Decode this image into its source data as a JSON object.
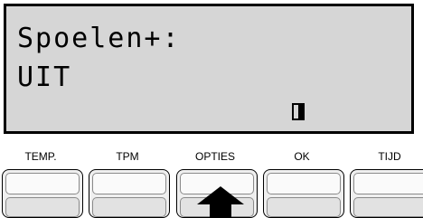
{
  "display": {
    "line1": "Spoelen+:",
    "line2": "UIT",
    "cursor_icon": "block-cursor-icon"
  },
  "softkeys": [
    {
      "label": "TEMP."
    },
    {
      "label": "TPM"
    },
    {
      "label": "OPTIES"
    },
    {
      "label": "OK"
    },
    {
      "label": "TIJD"
    }
  ],
  "pointer": {
    "icon": "up-arrow-icon",
    "points_to": "OPTIES"
  },
  "colors": {
    "lcd_background": "#d6d6d6",
    "frame": "#000000"
  }
}
